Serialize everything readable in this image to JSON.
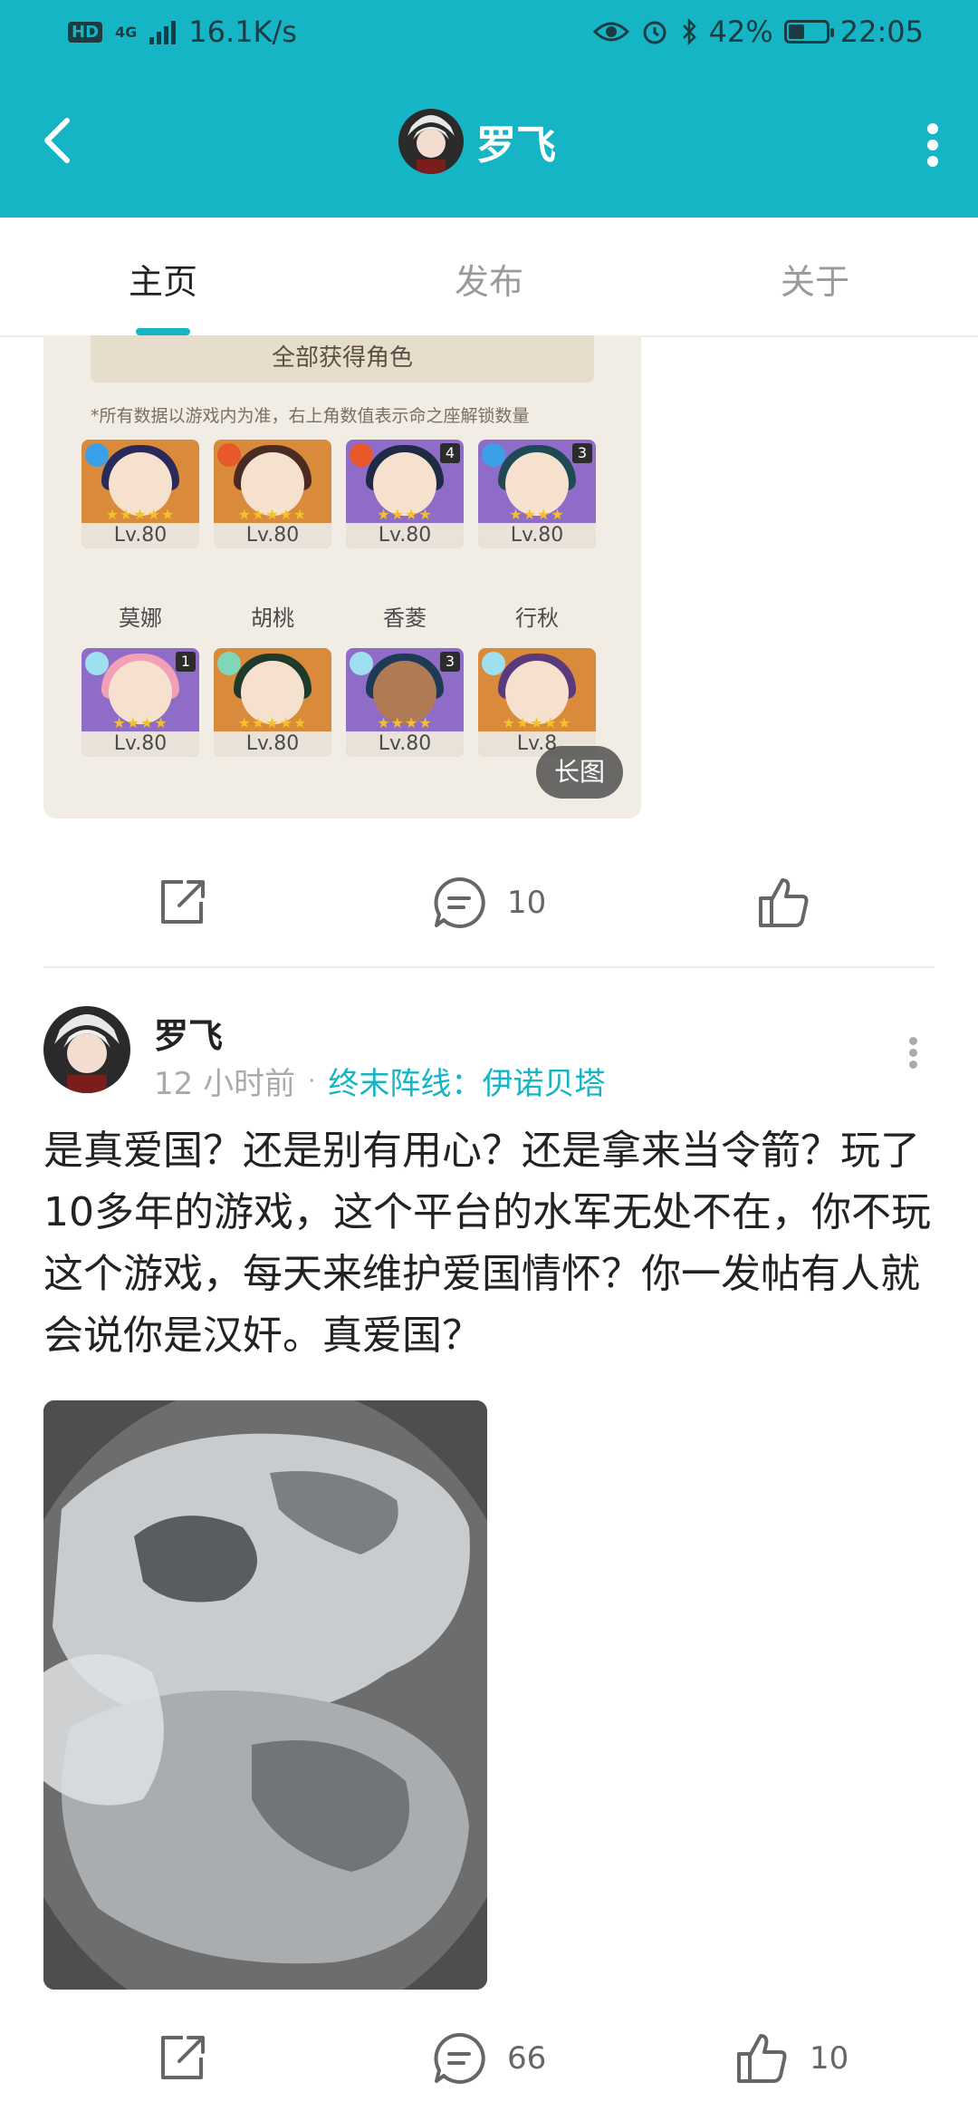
{
  "status_bar": {
    "hd": "HD",
    "network": "4G",
    "speed": "16.1K/s",
    "battery": "42%",
    "battery_level": 0.42,
    "time": "22:05"
  },
  "header": {
    "title": "罗飞"
  },
  "tabs": [
    {
      "label": "主页",
      "active": true
    },
    {
      "label": "发布",
      "active": false
    },
    {
      "label": "关于",
      "active": false
    }
  ],
  "post1": {
    "image": {
      "banner": "全部获得角色",
      "note": "*所有数据以游戏内为准，右上角数值表示命之座解锁数量",
      "characters": [
        {
          "name": "莫娜",
          "level": "Lv.80",
          "constellation": ""
        },
        {
          "name": "胡桃",
          "level": "Lv.80",
          "constellation": ""
        },
        {
          "name": "香菱",
          "level": "Lv.80",
          "constellation": "4"
        },
        {
          "name": "行秋",
          "level": "Lv.80",
          "constellation": "3"
        },
        {
          "name": "",
          "level": "Lv.80",
          "constellation": "1"
        },
        {
          "name": "",
          "level": "Lv.80",
          "constellation": ""
        },
        {
          "name": "",
          "level": "Lv.80",
          "constellation": "3"
        },
        {
          "name": "",
          "level": "Lv.8",
          "constellation": ""
        }
      ],
      "badge": "长图"
    },
    "comment_count": "10",
    "like_count": ""
  },
  "post2": {
    "author": "罗飞",
    "time": "12 小时前",
    "separator": "·",
    "topic": "终末阵线：伊诺贝塔",
    "text": "是真爱国？还是别有用心？还是拿来当令箭？玩了10多年的游戏，这个平台的水军无处不在，你不玩这个游戏，每天来维护爱国情怀？你一发帖有人就会说你是汉奸。真爱国？",
    "comment_count": "66",
    "like_count": "10"
  },
  "colors": {
    "accent": "#16b5c6",
    "text": "#222222",
    "muted": "#aaaaaa"
  }
}
